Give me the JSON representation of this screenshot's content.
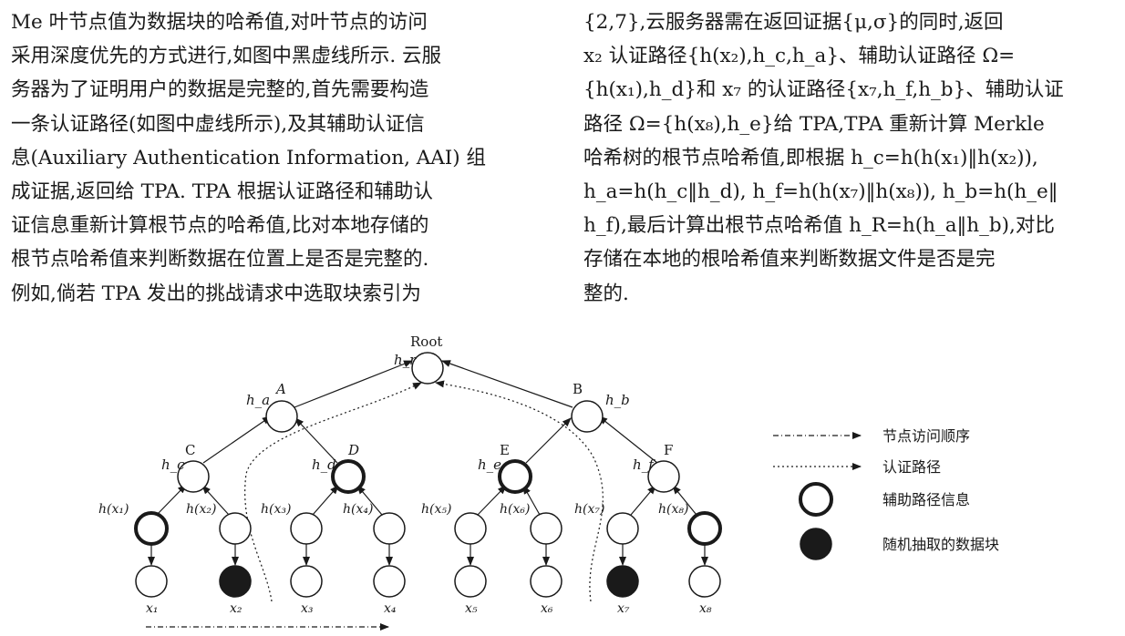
{
  "paragraph_left": [
    "Me 叶节点值为数据块的哈希值,对叶节点的访问",
    "采用深度优先的方式进行,如图中黑虚线所示. 云服",
    "务器为了证明用户的数据是完整的,首先需要构造",
    "一条认证路径(如图中虚线所示),及其辅助认证信",
    "息(Auxiliary Authentication Information, AAI) 组",
    "成证据,返回给 TPA. TPA 根据认证路径和辅助认",
    "证信息重新计算根节点的哈希值,比对本地存储的",
    "根节点哈希值来判断数据在位置上是否是完整的.",
    "例如,倘若 TPA 发出的挑战请求中选取块索引为"
  ],
  "paragraph_right": [
    "{2,7},云服务器需在返回证据{μ,σ}的同时,返回",
    "x₂ 认证路径{h(x₂),h_c,h_a}、辅助认证路径 Ω=",
    "{h(x₁),h_d}和 x₇ 的认证路径{x₇,h_f,h_b}、辅助认证",
    "路径 Ω={h(x₈),h_e}给 TPA,TPA 重新计算 Merkle",
    "哈希树的根节点哈希值,即根据 h_c=h(h(x₁)‖h(x₂)),",
    "h_a=h(h_c‖h_d), h_f=h(h(x₇)‖h(x₈)), h_b=h(h_e‖",
    "h_f),最后计算出根节点哈希值 h_R=h(h_a‖h_b),对比",
    "存储在本地的根哈希值来判断数据文件是否是完",
    "整的."
  ],
  "diagram": {
    "root_label": "Root",
    "root_hash": "h_r",
    "internal_labels": [
      "A",
      "B",
      "C",
      "D",
      "E",
      "F"
    ],
    "internal_hashes": [
      "h_a",
      "h_b",
      "h_c",
      "h_d",
      "h_e",
      "h_f"
    ],
    "leaf_hash_labels": [
      "h(x₁)",
      "h(x₂)",
      "h(x₃)",
      "h(x₄)",
      "h(x₅)",
      "h(x₆)",
      "h(x₇)",
      "h(x₈)"
    ],
    "block_labels": [
      "x₁",
      "x₂",
      "x₃",
      "x₄",
      "x₅",
      "x₆",
      "x₇",
      "x₈"
    ],
    "aux_path_nodes": [
      "D",
      "E",
      "h(x₁)",
      "h(x₈)"
    ],
    "sampled_blocks": [
      "x₂",
      "x₇"
    ]
  },
  "legend": {
    "visit_order": "节点访问顺序",
    "auth_path": "认证路径",
    "aux_info": "辅助路径信息",
    "sampled_block": "随机抽取的数据块"
  }
}
